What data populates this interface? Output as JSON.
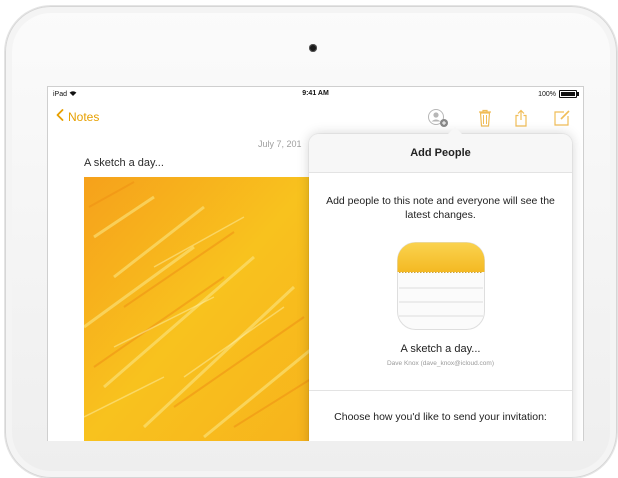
{
  "status": {
    "device": "iPad",
    "time": "9:41 AM",
    "battery": "100%",
    "battery_level": 1.0
  },
  "nav": {
    "back_label": "Notes"
  },
  "note": {
    "date": "July 7, 201",
    "title": "A sketch a day..."
  },
  "popover": {
    "title": "Add People",
    "description": "Add people to this note and everyone will see the latest changes.",
    "note_title": "A sketch a day...",
    "owner": "Dave Knox (dave_knox@icloud.com)",
    "choose_prompt": "Choose how you'd like to send your invitation:"
  },
  "colors": {
    "accent": "#e7a000",
    "notepad_yellow": "#f7c32e",
    "sketch_yellow": "#f7bf1d"
  },
  "icons": [
    "wifi-icon",
    "chevron-left-icon",
    "add-people-icon",
    "trash-icon",
    "share-icon",
    "compose-icon",
    "notepad-icon"
  ]
}
